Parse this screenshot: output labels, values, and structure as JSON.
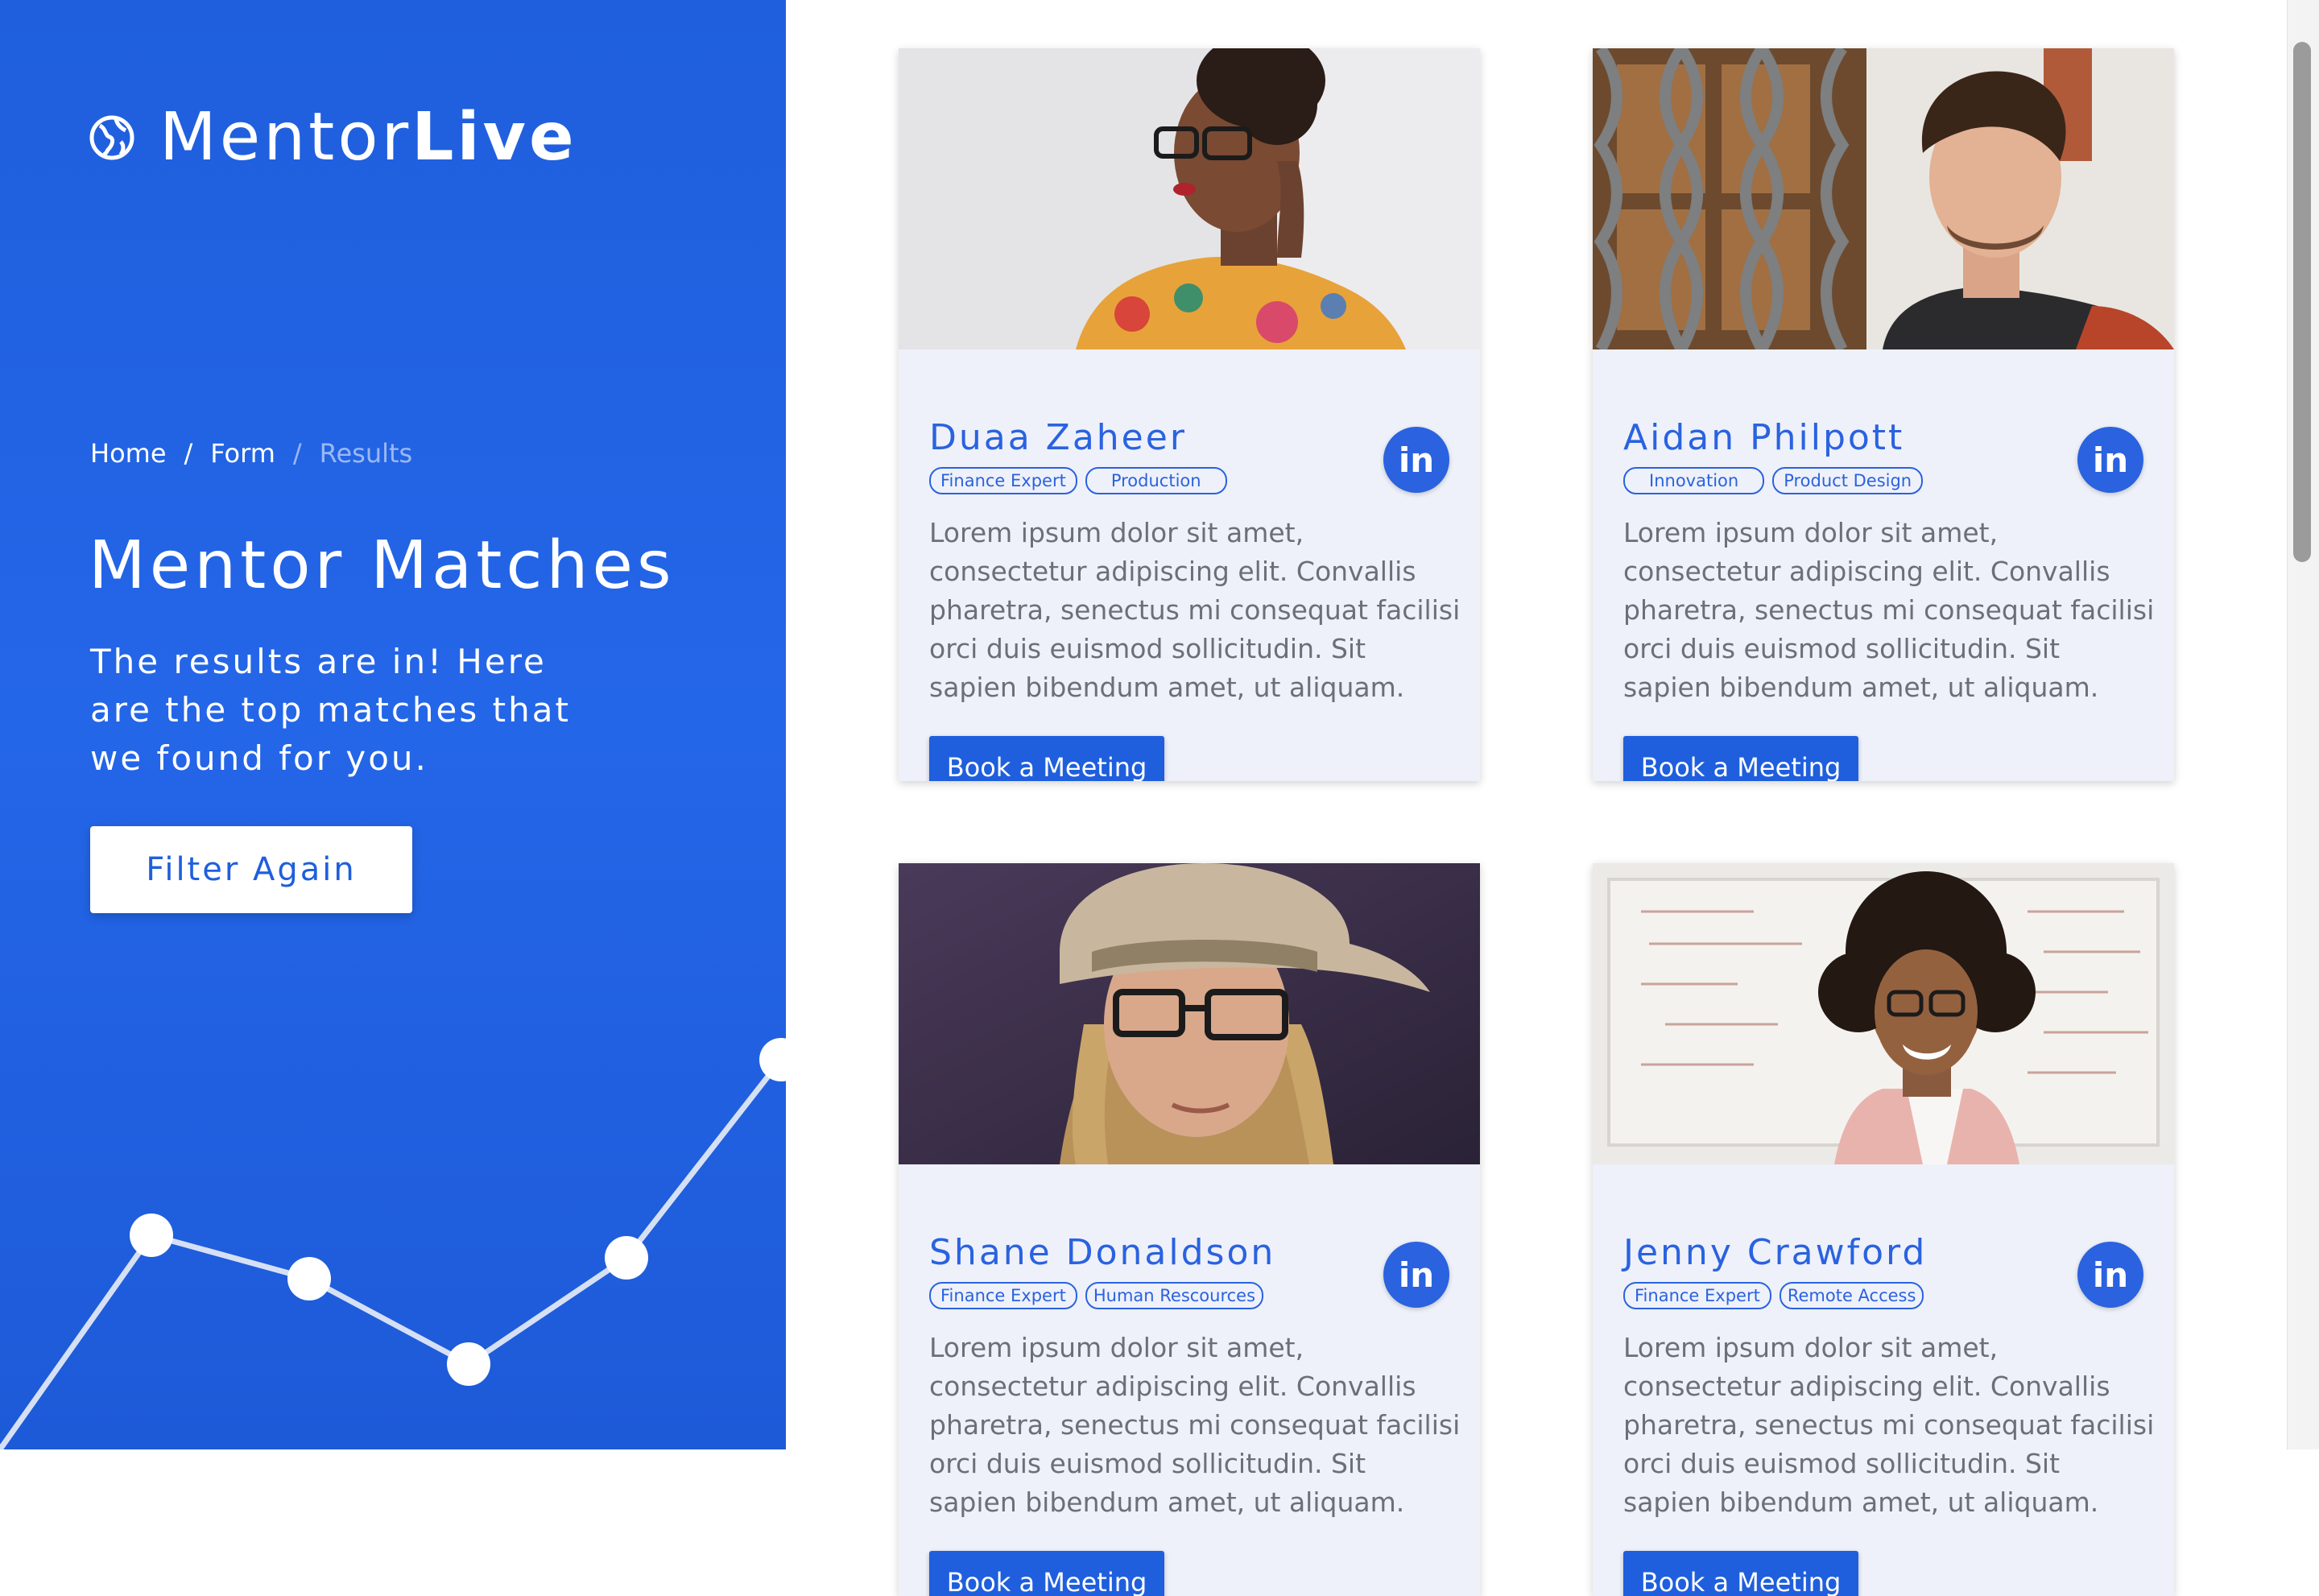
{
  "brand": {
    "name_light": "Mentor",
    "name_bold": "Live"
  },
  "breadcrumb": {
    "items": [
      "Home",
      "Form",
      "Results"
    ],
    "separator": "/"
  },
  "hero": {
    "title": "Mentor Matches",
    "subtitle": "The results are in! Here are the top matches that we found for you.",
    "filter_button": "Filter Again"
  },
  "colors": {
    "brand_blue": "#1f5fdd",
    "accent_blue": "#2a62e0",
    "card_bg": "#eef1f9",
    "text_gray": "#6b6f78"
  },
  "mentors": [
    {
      "name": "Duaa Zaheer",
      "tags": [
        "Finance Expert",
        "Production"
      ],
      "description": "Lorem ipsum dolor sit amet, consectetur adipiscing elit. Convallis pharetra, senectus mi consequat facilisi orci duis euismod sollicitudin. Sit sapien bibendum amet, ut aliquam.",
      "button": "Book a Meeting",
      "social_icon": "in"
    },
    {
      "name": "Aidan Philpott",
      "tags": [
        "Innovation",
        "Product Design"
      ],
      "description": "Lorem ipsum dolor sit amet, consectetur adipiscing elit. Convallis pharetra, senectus mi consequat facilisi orci duis euismod sollicitudin. Sit sapien bibendum amet, ut aliquam.",
      "button": "Book a Meeting",
      "social_icon": "in"
    },
    {
      "name": "Shane Donaldson",
      "tags": [
        "Finance Expert",
        "Human Rescources"
      ],
      "description": "Lorem ipsum dolor sit amet, consectetur adipiscing elit. Convallis pharetra, senectus mi consequat facilisi orci duis euismod sollicitudin. Sit sapien bibendum amet, ut aliquam.",
      "button": "Book a Meeting",
      "social_icon": "in"
    },
    {
      "name": "Jenny Crawford",
      "tags": [
        "Finance Expert",
        "Remote Access"
      ],
      "description": "Lorem ipsum dolor sit amet, consectetur adipiscing elit. Convallis pharetra, senectus mi consequat facilisi orci duis euismod sollicitudin. Sit sapien bibendum amet, ut aliquam.",
      "button": "Book a Meeting",
      "social_icon": "in"
    }
  ]
}
